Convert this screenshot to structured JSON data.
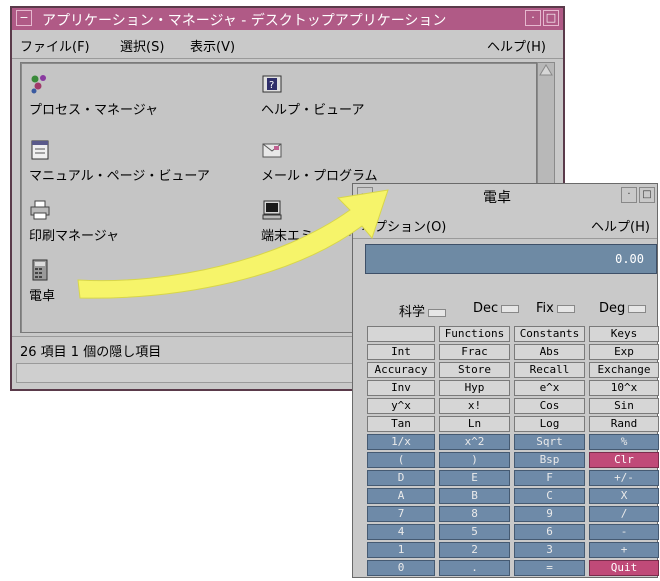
{
  "app_window": {
    "title": "アプリケーション・マネージャ - デスクトップアプリケーション",
    "menu": {
      "file": "ファイル(F)",
      "select": "選択(S)",
      "view": "表示(V)",
      "help": "ヘルプ(H)"
    },
    "icons": [
      {
        "label": "プロセス・マネージャ",
        "icon": "process-manager-icon"
      },
      {
        "label": "ヘルプ・ビューア",
        "icon": "help-viewer-icon"
      },
      {
        "label": "マニュアル・ページ・ビューア",
        "icon": "man-page-viewer-icon"
      },
      {
        "label": "メール・プログラム",
        "icon": "mail-program-icon"
      },
      {
        "label": "印刷マネージャ",
        "icon": "print-manager-icon"
      },
      {
        "label": "端末エミュレータ",
        "icon": "terminal-icon"
      },
      {
        "label": "電卓",
        "icon": "calculator-icon"
      }
    ],
    "status": "26 項目 1 個の隠し項目"
  },
  "calc_window": {
    "title": "電卓",
    "menu": {
      "options": "オプション(O)",
      "help": "ヘルプ(H)"
    },
    "display": "0.00",
    "modes": {
      "mode": "科学",
      "base": "Dec",
      "notation": "Fix",
      "angle": "Deg"
    },
    "keys": [
      [
        "",
        "Functions",
        "Constants",
        "Keys"
      ],
      [
        "Int",
        "Frac",
        "Abs",
        "Exp"
      ],
      [
        "Accuracy",
        "Store",
        "Recall",
        "Exchange"
      ],
      [
        "Inv",
        "Hyp",
        "e^x",
        "10^x"
      ],
      [
        "y^x",
        "x!",
        "Cos",
        "Sin"
      ],
      [
        "Tan",
        "Ln",
        "Log",
        "Rand"
      ],
      [
        "1/x",
        "x^2",
        "Sqrt",
        "%"
      ],
      [
        "(",
        ")",
        "Bsp",
        "Clr"
      ],
      [
        "D",
        "E",
        "F",
        "+/-"
      ],
      [
        "A",
        "B",
        "C",
        "X"
      ],
      [
        "7",
        "8",
        "9",
        "/"
      ],
      [
        "4",
        "5",
        "6",
        "-"
      ],
      [
        "1",
        "2",
        "3",
        "+"
      ],
      [
        "0",
        ".",
        "=",
        "Quit"
      ]
    ]
  },
  "colors": {
    "titlebar": "#b05a86",
    "display": "#6e8aa4",
    "key_gray": "#d6d6d6",
    "key_blue": "#6e8aa8",
    "key_red": "#c04a78",
    "arrow": "#f6f46a"
  }
}
